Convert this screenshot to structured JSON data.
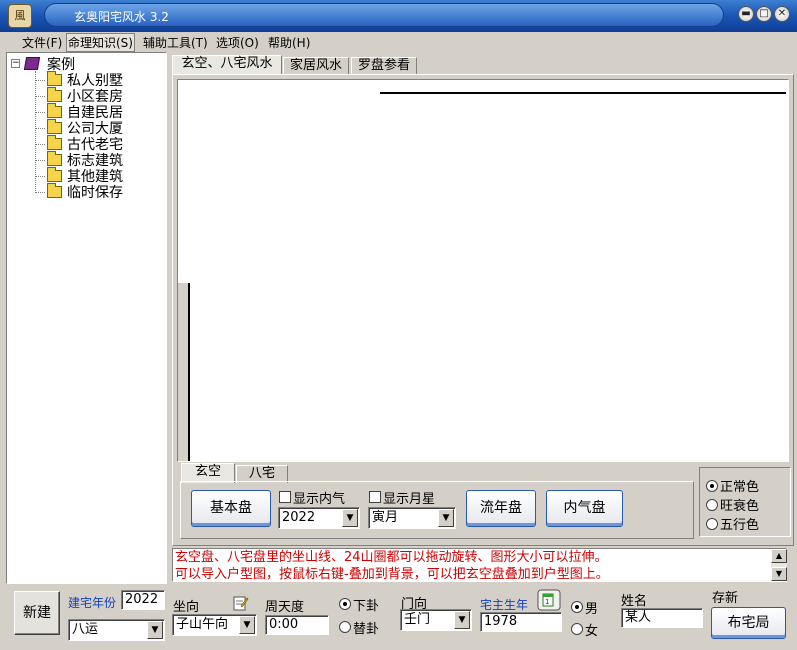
{
  "window": {
    "icon_glyph": "風",
    "title": "玄奥阳宅风水 3.2",
    "min_glyph": "▬",
    "max_glyph": "□",
    "close_glyph": "✕"
  },
  "menu": [
    {
      "label": "文件(F)"
    },
    {
      "label": "命理知识(S)"
    },
    {
      "label": "辅助工具(T)"
    },
    {
      "label": "选项(O)"
    },
    {
      "label": "帮助(H)"
    }
  ],
  "tree": {
    "expander": "−",
    "root": "案例",
    "items": [
      "私人别墅",
      "小区套房",
      "自建民居",
      "公司大厦",
      "古代老宅",
      "标志建筑",
      "其他建筑",
      "临时保存"
    ]
  },
  "tabs": [
    "玄空、八宅风水",
    "家居风水",
    "罗盘参看"
  ],
  "subtabs": [
    "玄空",
    "八宅"
  ],
  "controls": {
    "basic_btn": "基本盘",
    "show_inner_qi": "显示内气",
    "show_month_star": "显示月星",
    "year_select": "2022",
    "month_select": "寅月",
    "flow_year_btn": "流年盘",
    "inner_qi_btn": "内气盘",
    "combo_arrow": "▼"
  },
  "color_mode": {
    "options": [
      "正常色",
      "旺衰色",
      "五行色"
    ],
    "selected": 0
  },
  "message": [
    "玄空盘、八宅盘里的坐山线、24山圈都可以拖动旋转、图形大小可以拉伸。",
    "可以导入户型图，按鼠标右键-叠加到背景，可以把玄空盘叠加到户型图上。"
  ],
  "scroll": {
    "up": "▲",
    "down": "▼"
  },
  "bottom": {
    "new_btn": "新建",
    "build_year_label": "建宅年份",
    "build_year": "2022",
    "period_select": "八运",
    "sitting_label": "坐向",
    "sitting_select": "子山午向",
    "degree_label": "周天度",
    "degree": "0:00",
    "gua_options": [
      "下卦",
      "替卦"
    ],
    "gua_selected": 0,
    "door_label": "门向",
    "door_select": "壬门",
    "owner_year_label": "宅主生年",
    "owner_year": "1978",
    "gender_options": [
      "男",
      "女"
    ],
    "gender_selected": 0,
    "name_label": "姓名",
    "name": "某人",
    "save_label": "存新",
    "layout_btn": "布宅局"
  }
}
